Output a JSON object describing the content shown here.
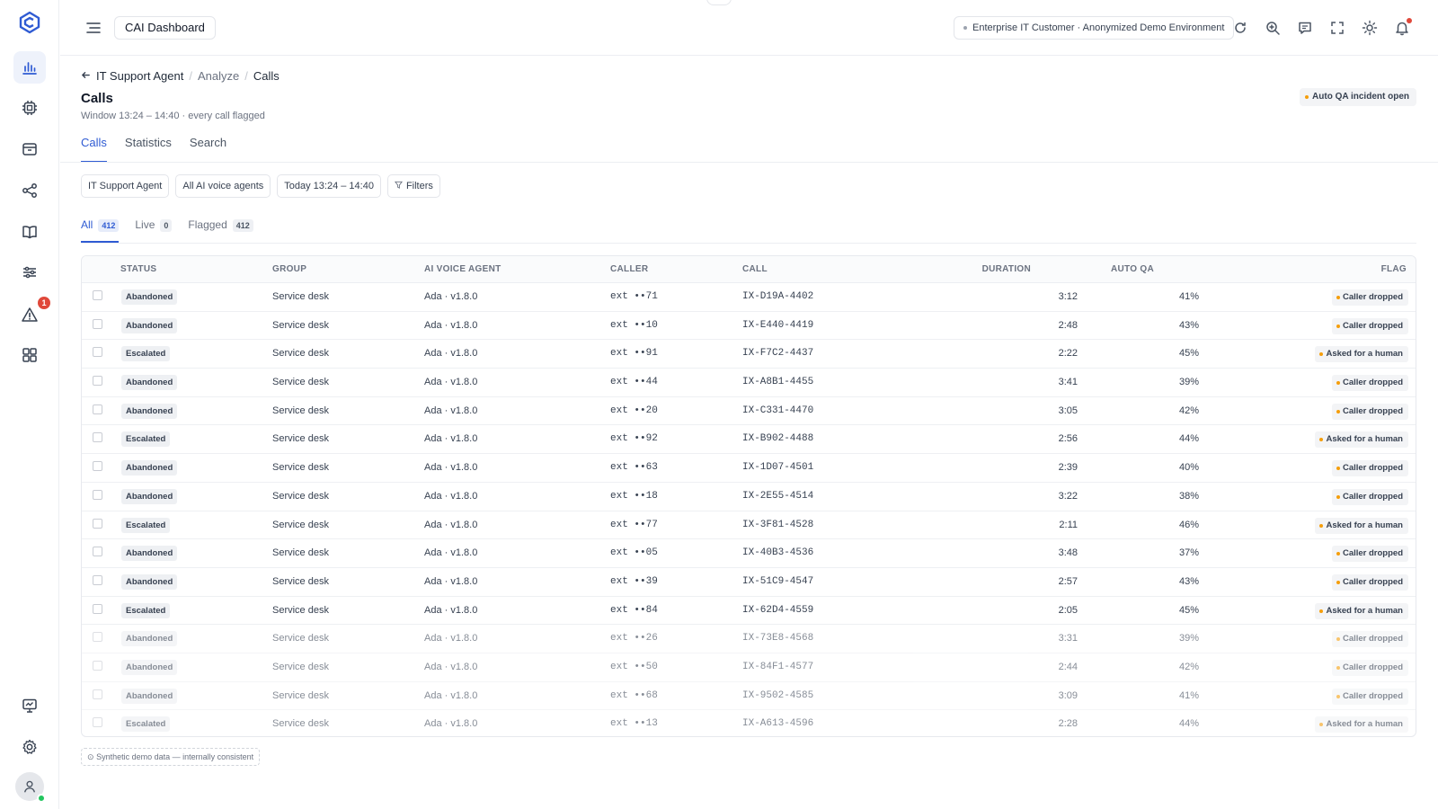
{
  "header": {
    "dashboard_label": "CAI Dashboard",
    "environment": "Enterprise IT Customer · Anonymized Demo Environment"
  },
  "sidebar": {
    "alerts_badge": "1",
    "items": [
      "analytics-icon",
      "chip-icon",
      "archive-icon",
      "share-icon",
      "book-icon",
      "sliders-icon",
      "alert-icon",
      "grid-icon",
      "monitor-icon",
      "gear-icon"
    ]
  },
  "breadcrumb": {
    "back": "IT Support Agent",
    "middle": "Analyze",
    "current": "Calls"
  },
  "page": {
    "title": "Calls",
    "subtitle": "Window 13:24 – 14:40 · every call flagged",
    "incident_badge": "Auto QA incident open"
  },
  "tabs": [
    "Calls",
    "Statistics",
    "Search"
  ],
  "filters": {
    "agent": "IT Support Agent",
    "voice_agents": "All AI voice agents",
    "time": "Today 13:24 – 14:40",
    "filters_label": "Filters"
  },
  "subtabs": [
    {
      "label": "All",
      "count": "412"
    },
    {
      "label": "Live",
      "count": "0"
    },
    {
      "label": "Flagged",
      "count": "412"
    }
  ],
  "table": {
    "columns": [
      "STATUS",
      "GROUP",
      "AI VOICE AGENT",
      "CALLER",
      "CALL",
      "DURATION",
      "AUTO QA",
      "FLAG"
    ],
    "rows": [
      {
        "status": "Abandoned",
        "group": "Service desk",
        "agent": "Ada · v1.8.0",
        "caller": "ext ••71",
        "call": "IX-D19A-4402",
        "duration": "3:12",
        "qa": "41%",
        "flag": "Caller dropped"
      },
      {
        "status": "Abandoned",
        "group": "Service desk",
        "agent": "Ada · v1.8.0",
        "caller": "ext ••10",
        "call": "IX-E440-4419",
        "duration": "2:48",
        "qa": "43%",
        "flag": "Caller dropped"
      },
      {
        "status": "Escalated",
        "group": "Service desk",
        "agent": "Ada · v1.8.0",
        "caller": "ext ••91",
        "call": "IX-F7C2-4437",
        "duration": "2:22",
        "qa": "45%",
        "flag": "Asked for a human"
      },
      {
        "status": "Abandoned",
        "group": "Service desk",
        "agent": "Ada · v1.8.0",
        "caller": "ext ••44",
        "call": "IX-A8B1-4455",
        "duration": "3:41",
        "qa": "39%",
        "flag": "Caller dropped"
      },
      {
        "status": "Abandoned",
        "group": "Service desk",
        "agent": "Ada · v1.8.0",
        "caller": "ext ••20",
        "call": "IX-C331-4470",
        "duration": "3:05",
        "qa": "42%",
        "flag": "Caller dropped"
      },
      {
        "status": "Escalated",
        "group": "Service desk",
        "agent": "Ada · v1.8.0",
        "caller": "ext ••92",
        "call": "IX-B902-4488",
        "duration": "2:56",
        "qa": "44%",
        "flag": "Asked for a human"
      },
      {
        "status": "Abandoned",
        "group": "Service desk",
        "agent": "Ada · v1.8.0",
        "caller": "ext ••63",
        "call": "IX-1D07-4501",
        "duration": "2:39",
        "qa": "40%",
        "flag": "Caller dropped"
      },
      {
        "status": "Abandoned",
        "group": "Service desk",
        "agent": "Ada · v1.8.0",
        "caller": "ext ••18",
        "call": "IX-2E55-4514",
        "duration": "3:22",
        "qa": "38%",
        "flag": "Caller dropped"
      },
      {
        "status": "Escalated",
        "group": "Service desk",
        "agent": "Ada · v1.8.0",
        "caller": "ext ••77",
        "call": "IX-3F81-4528",
        "duration": "2:11",
        "qa": "46%",
        "flag": "Asked for a human"
      },
      {
        "status": "Abandoned",
        "group": "Service desk",
        "agent": "Ada · v1.8.0",
        "caller": "ext ••05",
        "call": "IX-40B3-4536",
        "duration": "3:48",
        "qa": "37%",
        "flag": "Caller dropped"
      },
      {
        "status": "Abandoned",
        "group": "Service desk",
        "agent": "Ada · v1.8.0",
        "caller": "ext ••39",
        "call": "IX-51C9-4547",
        "duration": "2:57",
        "qa": "43%",
        "flag": "Caller dropped"
      },
      {
        "status": "Escalated",
        "group": "Service desk",
        "agent": "Ada · v1.8.0",
        "caller": "ext ••84",
        "call": "IX-62D4-4559",
        "duration": "2:05",
        "qa": "45%",
        "flag": "Asked for a human"
      },
      {
        "status": "Abandoned",
        "group": "Service desk",
        "agent": "Ada · v1.8.0",
        "caller": "ext ••26",
        "call": "IX-73E8-4568",
        "duration": "3:31",
        "qa": "39%",
        "flag": "Caller dropped"
      },
      {
        "status": "Abandoned",
        "group": "Service desk",
        "agent": "Ada · v1.8.0",
        "caller": "ext ••50",
        "call": "IX-84F1-4577",
        "duration": "2:44",
        "qa": "42%",
        "flag": "Caller dropped"
      },
      {
        "status": "Abandoned",
        "group": "Service desk",
        "agent": "Ada · v1.8.0",
        "caller": "ext ••68",
        "call": "IX-9502-4585",
        "duration": "3:09",
        "qa": "41%",
        "flag": "Caller dropped"
      },
      {
        "status": "Escalated",
        "group": "Service desk",
        "agent": "Ada · v1.8.0",
        "caller": "ext ••13",
        "call": "IX-A613-4596",
        "duration": "2:28",
        "qa": "44%",
        "flag": "Asked for a human"
      }
    ]
  },
  "footer_note": "Synthetic demo data — internally consistent",
  "colors": {
    "accent": "#2f5bd3",
    "flag_dot": "#f59e0b",
    "alert_badge": "#e0483a",
    "online": "#22c55e"
  }
}
